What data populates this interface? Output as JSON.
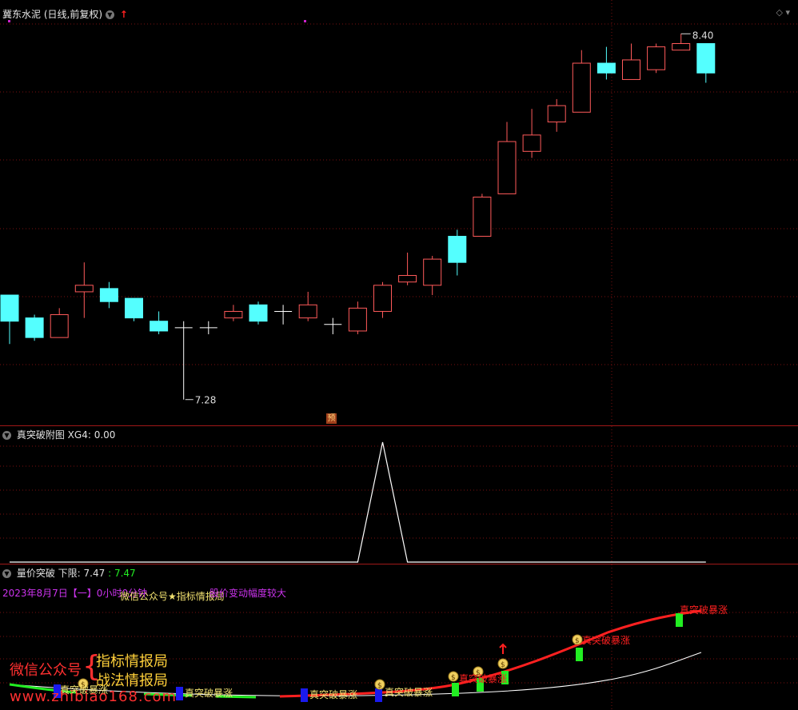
{
  "main": {
    "stock_title": "冀东水泥",
    "period_label": "(日线,前复权)",
    "high_label": "8.40",
    "low_label": "7.28",
    "marker_label": "预"
  },
  "sub1": {
    "title": "真突破附图",
    "xg_label": "XG4:",
    "xg_value": "0.00"
  },
  "sub2": {
    "title": "量价突破",
    "lower_label": "下限:",
    "lower_value": "7.47",
    "lower_value2": ": 7.47",
    "date_text": "2023年8月7日【一】0小时0分钟",
    "overlay_text": "微信公众号★指标情报局",
    "comment_text": "股价变动幅度较大",
    "signal_label": "真突破暴涨",
    "year_label": "2023年"
  },
  "watermark": {
    "wechat_label": "微信公众号",
    "line1": "指标情报局",
    "line2": "战法情报局",
    "url": "www.zhibiao168.com"
  },
  "colors": {
    "up": "#ff5a5a",
    "down": "#54ffff",
    "grid": "#7a1010",
    "divider": "#a01818",
    "signal_line": "#ff2020",
    "green_line": "#22ee22",
    "white_line": "#ffffff"
  },
  "chart_data": {
    "type": "candlestick",
    "candles": [
      {
        "o": 7.6,
        "c": 7.52,
        "h": 7.6,
        "l": 7.45
      },
      {
        "o": 7.53,
        "c": 7.47,
        "h": 7.54,
        "l": 7.46
      },
      {
        "o": 7.47,
        "c": 7.54,
        "h": 7.56,
        "l": 7.47
      },
      {
        "o": 7.61,
        "c": 7.63,
        "h": 7.7,
        "l": 7.53
      },
      {
        "o": 7.62,
        "c": 7.58,
        "h": 7.64,
        "l": 7.56
      },
      {
        "o": 7.59,
        "c": 7.53,
        "h": 7.59,
        "l": 7.52
      },
      {
        "o": 7.52,
        "c": 7.49,
        "h": 7.55,
        "l": 7.48
      },
      {
        "o": 7.5,
        "c": 7.5,
        "h": 7.52,
        "l": 7.28
      },
      {
        "o": 7.5,
        "c": 7.5,
        "h": 7.52,
        "l": 7.48
      },
      {
        "o": 7.53,
        "c": 7.55,
        "h": 7.57,
        "l": 7.52
      },
      {
        "o": 7.57,
        "c": 7.52,
        "h": 7.58,
        "l": 7.51
      },
      {
        "o": 7.55,
        "c": 7.55,
        "h": 7.57,
        "l": 7.51
      },
      {
        "o": 7.53,
        "c": 7.57,
        "h": 7.61,
        "l": 7.52
      },
      {
        "o": 7.51,
        "c": 7.51,
        "h": 7.53,
        "l": 7.48
      },
      {
        "o": 7.49,
        "c": 7.56,
        "h": 7.58,
        "l": 7.48
      },
      {
        "o": 7.55,
        "c": 7.63,
        "h": 7.64,
        "l": 7.53
      },
      {
        "o": 7.64,
        "c": 7.66,
        "h": 7.73,
        "l": 7.63
      },
      {
        "o": 7.63,
        "c": 7.71,
        "h": 7.72,
        "l": 7.6
      },
      {
        "o": 7.78,
        "c": 7.7,
        "h": 7.8,
        "l": 7.66
      },
      {
        "o": 7.78,
        "c": 7.9,
        "h": 7.91,
        "l": 7.78
      },
      {
        "o": 7.91,
        "c": 8.07,
        "h": 8.13,
        "l": 7.91
      },
      {
        "o": 8.04,
        "c": 8.09,
        "h": 8.17,
        "l": 8.02
      },
      {
        "o": 8.13,
        "c": 8.18,
        "h": 8.2,
        "l": 8.1
      },
      {
        "o": 8.16,
        "c": 8.31,
        "h": 8.35,
        "l": 8.16
      },
      {
        "o": 8.31,
        "c": 8.28,
        "h": 8.36,
        "l": 8.26
      },
      {
        "o": 8.26,
        "c": 8.32,
        "h": 8.37,
        "l": 8.26
      },
      {
        "o": 8.29,
        "c": 8.36,
        "h": 8.37,
        "l": 8.28
      },
      {
        "o": 8.35,
        "c": 8.37,
        "h": 8.4,
        "l": 8.35
      },
      {
        "o": 8.37,
        "c": 8.28,
        "h": 8.37,
        "l": 8.25
      }
    ],
    "ylim": [
      7.25,
      8.43
    ],
    "xg4": [
      0,
      0,
      0,
      0,
      0,
      0,
      0,
      0,
      0,
      0,
      0,
      0,
      0,
      0,
      0,
      1,
      0,
      0,
      0,
      0,
      0,
      0,
      0,
      0,
      0,
      0,
      0,
      0,
      0
    ]
  }
}
